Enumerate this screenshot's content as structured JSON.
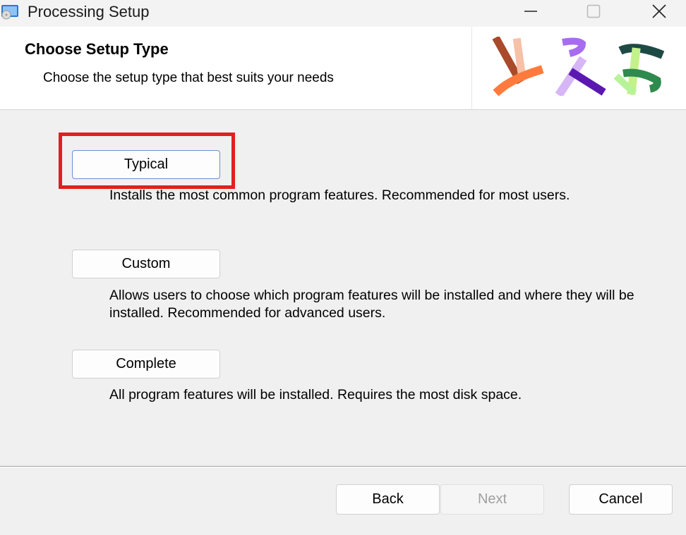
{
  "window": {
    "title": "Processing Setup"
  },
  "header": {
    "title": "Choose Setup Type",
    "subtitle": "Choose the setup type that best suits your needs",
    "logo": "processing-logo"
  },
  "options": [
    {
      "label": "Typical",
      "description": "Installs the most common program features. Recommended for most users.",
      "highlighted": true
    },
    {
      "label": "Custom",
      "description": "Allows users to choose which program features will be installed and where they will be installed. Recommended for advanced users."
    },
    {
      "label": "Complete",
      "description": "All program features will be installed. Requires the most disk space."
    }
  ],
  "footer": {
    "back_label": "Back",
    "next_label": "Next",
    "next_enabled": false,
    "cancel_label": "Cancel"
  },
  "colors": {
    "highlight": "#e02020",
    "banner_bg": "#ffffff",
    "body_bg": "#f0f0f0"
  }
}
